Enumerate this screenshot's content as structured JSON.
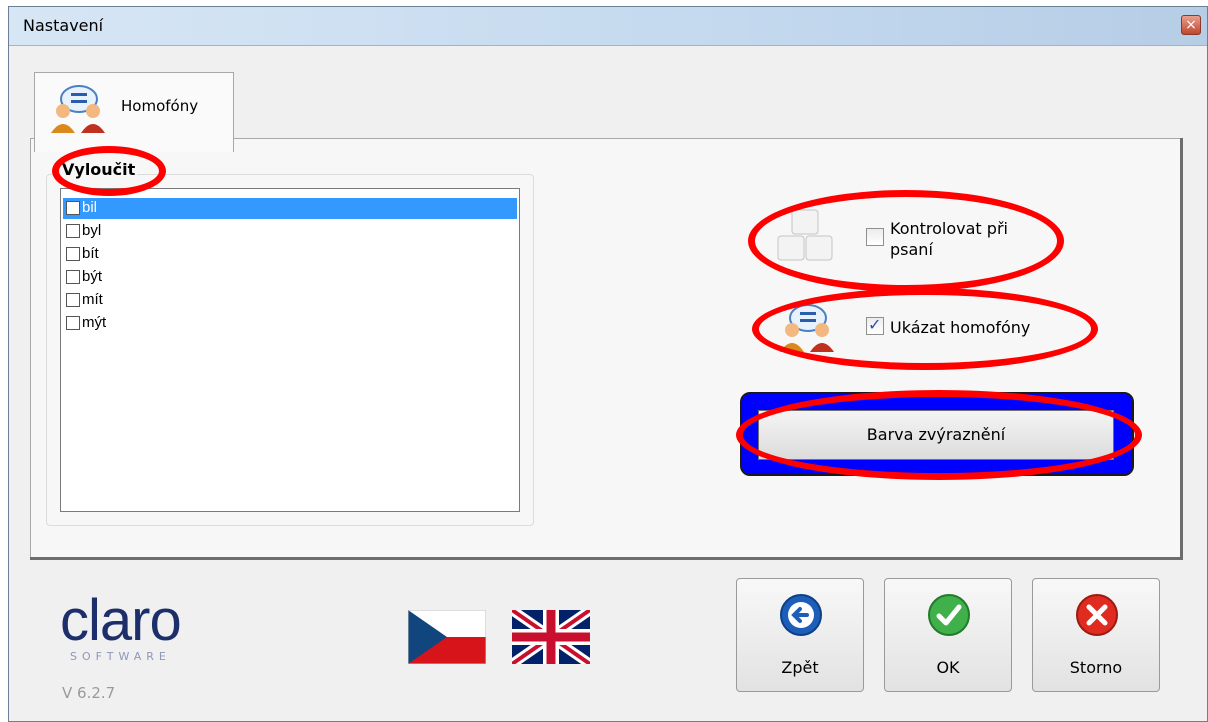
{
  "window": {
    "title": "Nastavení",
    "close_glyph": "×"
  },
  "tab": {
    "label": "Homofóny",
    "icon": "homophones-icon"
  },
  "exclude": {
    "title": "Vyloučit",
    "items": [
      "bil",
      "byl",
      "bít",
      "být",
      "mít",
      "mýt"
    ],
    "selected_index": 0
  },
  "options": {
    "check_while_typing": {
      "label_line1": "Kontrolovat při",
      "label_line2": "psaní",
      "checked": false,
      "icon": "keyboard-keys-icon"
    },
    "show_homophones": {
      "label": "Ukázat homofóny",
      "checked": true,
      "icon": "homophones-icon"
    }
  },
  "highlight": {
    "label": "Barva zvýraznění",
    "color": "#0000ff"
  },
  "footer": {
    "logo_main": "claro",
    "logo_sub": "SOFTWARE",
    "version": "V 6.2.7",
    "flags": [
      "czech-flag-icon",
      "uk-flag-icon"
    ],
    "buttons": {
      "back": "Zpět",
      "ok": "OK",
      "cancel": "Storno"
    }
  },
  "annotation_color": "#ff0000"
}
